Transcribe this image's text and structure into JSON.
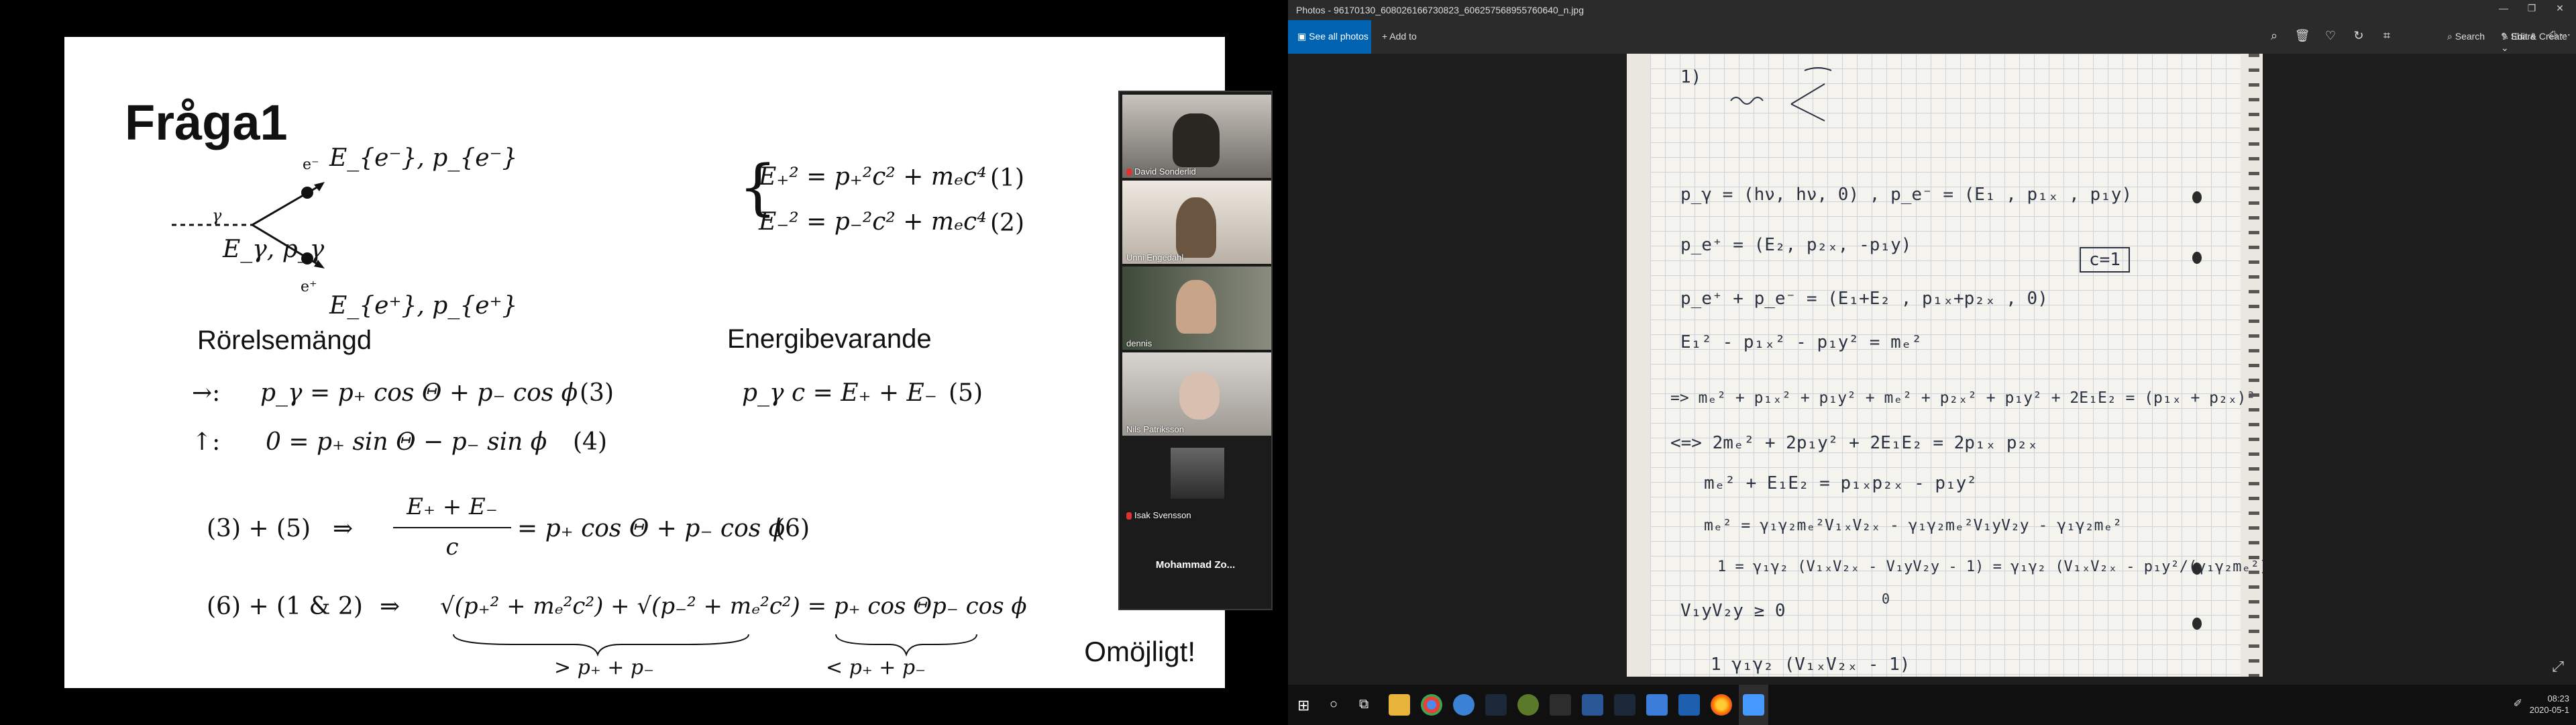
{
  "slide": {
    "title": "Fråga1",
    "diagram": {
      "electron_label": "e⁻",
      "electron_vars": "E_{e⁻}, p_{e⁻}",
      "positron_label": "e⁺",
      "positron_vars": "E_{e⁺}, p_{e⁺}",
      "photon_label": "γ",
      "photon_vars": "E_γ, p_γ"
    },
    "eq1": "E₊² = p₊²c² + mₑc⁴",
    "eq1_num": "(1)",
    "eq2": "E₋² = p₋²c² + mₑc⁴",
    "eq2_num": "(2)",
    "section_momentum": "Rörelsemängd",
    "section_energy": "Energibevarande",
    "eq3_dir": "→:",
    "eq3": "p_γ = p₊ cos Θ + p₋ cos ϕ",
    "eq3_num": "(3)",
    "eq4_dir": "↑:",
    "eq4": "0 = p₊ sin Θ − p₋ sin ϕ",
    "eq4_num": "(4)",
    "eq5": "p_γ c = E₊ + E₋",
    "eq5_num": "(5)",
    "eq6_lhs": "(3) + (5)",
    "eq6_arrow": "⇒",
    "eq6_frac_num": "E₊ + E₋",
    "eq6_frac_den": "c",
    "eq6_rhs": "= p₊ cos Θ + p₋ cos ϕ",
    "eq6_num": "(6)",
    "eq7_lhs": "(6) + (1 & 2)",
    "eq7_arrow": "⇒",
    "eq7_body": "√(p₊² + mₑ²c²) + √(p₋² + mₑ²c²) = p₊ cos Θp₋ cos ϕ",
    "brace_left": "> p₊ + p₋",
    "brace_right": "< p₊ + p₋",
    "conclusion": "Omöjligt!"
  },
  "video": {
    "participants": [
      {
        "name": "David Sonderlid",
        "muted": true
      },
      {
        "name": "Unni Engedahl",
        "muted": false
      },
      {
        "name": "dennis",
        "muted": false
      },
      {
        "name": "Nils Patriksson",
        "muted": false
      },
      {
        "name": "Isak Svensson",
        "muted": true
      }
    ],
    "name_only": "Mohammad Zo..."
  },
  "photos": {
    "window_title": "Photos - 96170130_608026166730823_606257568955760640_n.jpg",
    "see_all": "See all photos",
    "add_to": "Add to",
    "search": "Search",
    "edit_create": "Edit & Create",
    "share": "Share",
    "notes": [
      "1)",
      "p_γ = (hν, hν, 0)      ,   p_e⁻ = (E₁ , p₁ₓ , p₁y)",
      "p_e⁺ = (E₂, p₂ₓ, -p₁y)",
      "c=1",
      "p_e⁺ + p_e⁻ = (E₁+E₂ , p₁ₓ+p₂ₓ , 0)",
      "E₁² - p₁ₓ² - p₁y² = mₑ²",
      "=>  mₑ² + p₁ₓ² + p₁y² + mₑ² + p₂ₓ² + p₁y² + 2E₁E₂ = (p₁ₓ + p₂ₓ)²",
      "<=>  2mₑ² + 2p₁y² + 2E₁E₂ = 2p₁ₓ p₂ₓ",
      "mₑ² + E₁E₂ = p₁ₓp₂ₓ - p₁y²",
      "mₑ² = γ₁γ₂mₑ²V₁ₓV₂ₓ - γ₁γ₂mₑ²V₁yV₂y - γ₁γ₂mₑ²",
      "1 = γ₁γ₂ (V₁ₓV₂ₓ - V₁yV₂y - 1)  = γ₁γ₂ (V₁ₓV₂ₓ - p₁y²/(γ₁γ₂mₑ²) - 1)",
      "0",
      "V₁yV₂y ≥ 0",
      "1   γ₁γ₂ (V₁ₓV₂ₓ - 1)"
    ]
  },
  "taskbar": {
    "time": "08:23",
    "date": "2020-05-1"
  }
}
